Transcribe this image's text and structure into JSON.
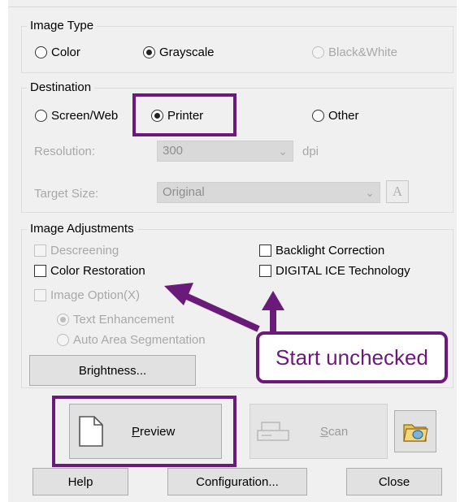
{
  "image_type": {
    "label": "Image Type",
    "options": [
      {
        "label": "Color",
        "selected": false,
        "enabled": true
      },
      {
        "label": "Grayscale",
        "selected": true,
        "enabled": true
      },
      {
        "label": "Black&White",
        "selected": false,
        "enabled": false
      }
    ]
  },
  "destination": {
    "label": "Destination",
    "options": [
      {
        "label": "Screen/Web",
        "selected": false,
        "enabled": true
      },
      {
        "label": "Printer",
        "selected": true,
        "enabled": true
      },
      {
        "label": "Other",
        "selected": false,
        "enabled": true
      }
    ],
    "resolution_label": "Resolution:",
    "resolution_value": "300",
    "resolution_unit": "dpi",
    "target_size_label": "Target Size:",
    "target_size_value": "Original",
    "font_button_glyph": "A"
  },
  "adjustments": {
    "label": "Image Adjustments",
    "descreening": "Descreening",
    "color_restoration": "Color Restoration",
    "image_option": "Image Option(X)",
    "text_enhancement": "Text Enhancement",
    "auto_area_segmentation": "Auto Area Segmentation",
    "backlight_correction": "Backlight Correction",
    "digital_ice": "DIGITAL ICE Technology",
    "brightness_button": "Brightness..."
  },
  "annotation": {
    "callout_text": "Start unchecked",
    "color": "#6a1b7a"
  },
  "actions": {
    "preview_mnemonic": "P",
    "preview_rest": "review",
    "scan_mnemonic": "S",
    "scan_rest": "can",
    "help": "Help",
    "configuration": "Configuration...",
    "close": "Close"
  },
  "icons": {
    "preview": "document-icon",
    "scan": "scanner-icon",
    "folder": "folder-icon"
  }
}
